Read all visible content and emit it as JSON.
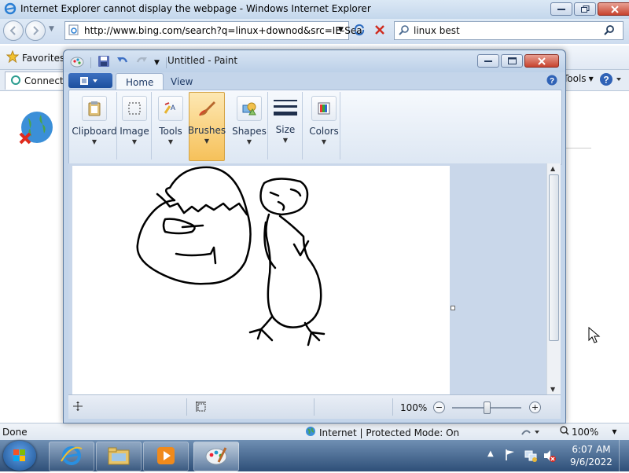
{
  "ie": {
    "title": "Internet Explorer cannot display the webpage - Windows Internet Explorer",
    "address": "http://www.bing.com/search?q=linux+downod&src=IE-Sea",
    "search_query": "linux best",
    "favorites_label": "Favorites",
    "tab_label": "Connecti",
    "tools_label": "Tools",
    "status_text": "Done",
    "zone_text": "Internet | Protected Mode: On",
    "zoom_text": "100%"
  },
  "paint": {
    "title": "Untitled - Paint",
    "tabs": [
      {
        "label": "Home",
        "active": true
      },
      {
        "label": "View",
        "active": false
      }
    ],
    "ribbon_groups": [
      {
        "label": "Clipboard",
        "icon": "clipboard-icon"
      },
      {
        "label": "Image",
        "icon": "select-icon"
      },
      {
        "label": "Tools",
        "icon": "tools-icon"
      },
      {
        "label": "Brushes",
        "icon": "brush-icon",
        "active": true
      },
      {
        "label": "Shapes",
        "icon": "shapes-icon"
      },
      {
        "label": "Size",
        "icon": "size-icon"
      },
      {
        "label": "Colors",
        "icon": "colors-icon"
      }
    ],
    "zoom_text": "100%",
    "zoom_level": 1.0
  },
  "taskbar": {
    "time": "6:07 AM",
    "date": "9/6/2022",
    "items": [
      "internet-explorer",
      "windows-explorer",
      "media-player",
      "paint"
    ]
  }
}
